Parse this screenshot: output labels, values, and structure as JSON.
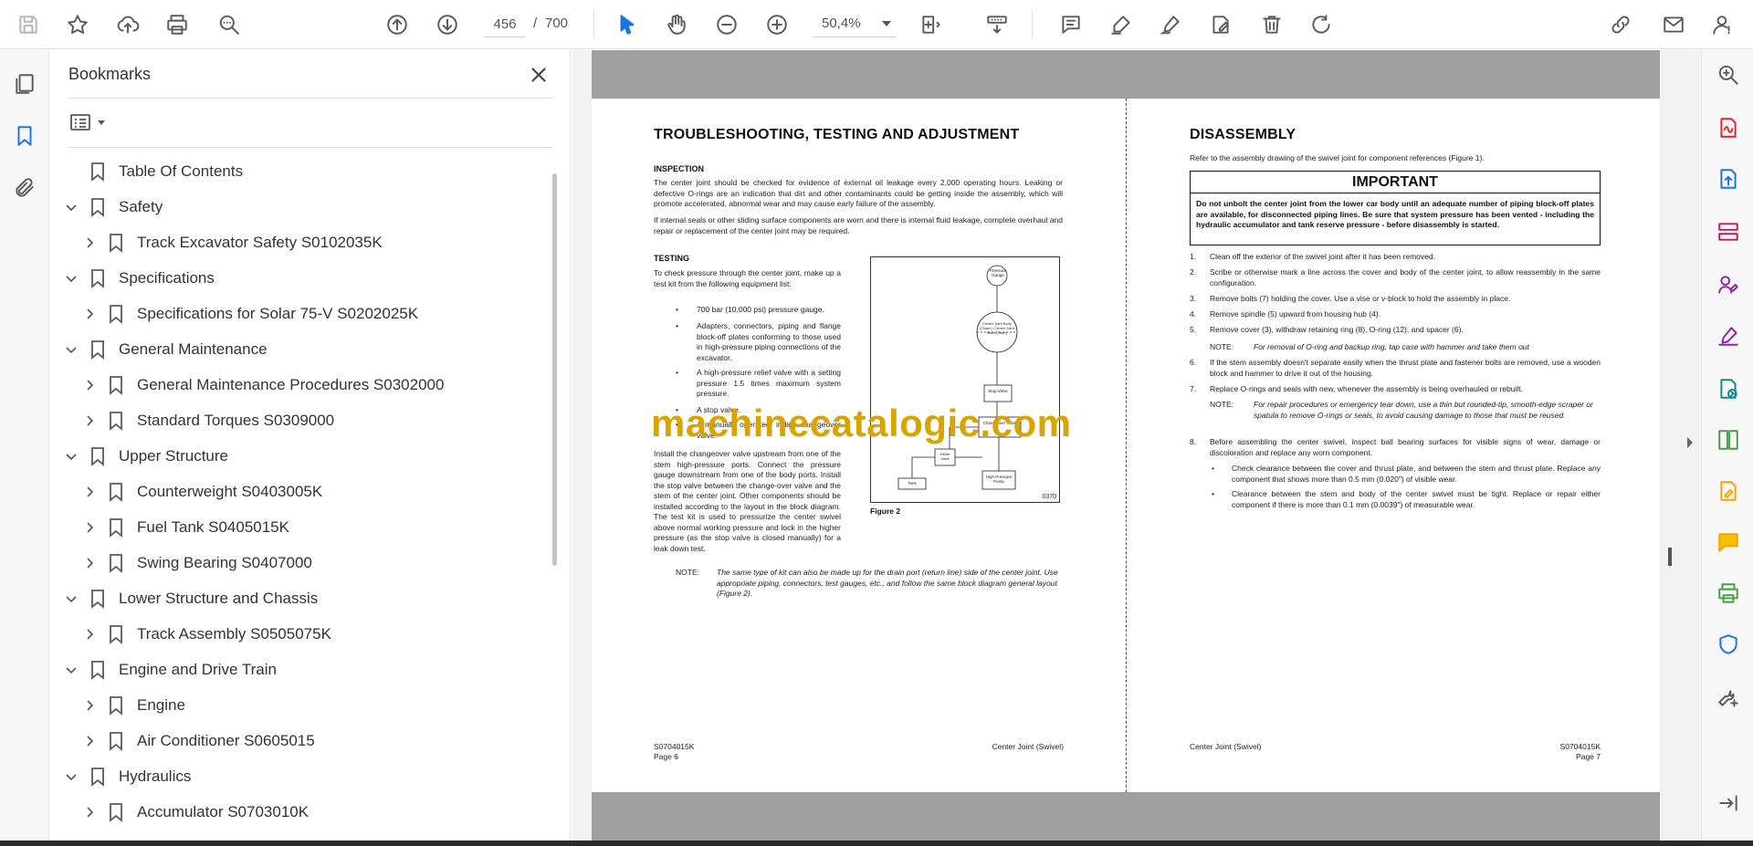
{
  "toolbar": {
    "current_page": "456",
    "page_separator": "/",
    "total_pages": "700",
    "zoom": "50,4%"
  },
  "bookmarks": {
    "title": "Bookmarks",
    "items": [
      {
        "label": "Table Of Contents",
        "level": 0,
        "expander": "none"
      },
      {
        "label": "Safety",
        "level": 0,
        "expander": "expanded"
      },
      {
        "label": "Track Excavator Safety S0102035K",
        "level": 1,
        "expander": "collapsed"
      },
      {
        "label": "Specifications",
        "level": 0,
        "expander": "expanded"
      },
      {
        "label": "Specifications for Solar 75-V S0202025K",
        "level": 1,
        "expander": "collapsed"
      },
      {
        "label": "General Maintenance",
        "level": 0,
        "expander": "expanded"
      },
      {
        "label": "General Maintenance Procedures S0302000",
        "level": 1,
        "expander": "collapsed"
      },
      {
        "label": "Standard Torques S0309000",
        "level": 1,
        "expander": "collapsed"
      },
      {
        "label": "Upper Structure",
        "level": 0,
        "expander": "expanded"
      },
      {
        "label": "Counterweight S0403005K",
        "level": 1,
        "expander": "collapsed"
      },
      {
        "label": "Fuel Tank S0405015K",
        "level": 1,
        "expander": "collapsed"
      },
      {
        "label": "Swing Bearing S0407000",
        "level": 1,
        "expander": "collapsed"
      },
      {
        "label": "Lower Structure and Chassis",
        "level": 0,
        "expander": "expanded"
      },
      {
        "label": "Track Assembly S0505075K",
        "level": 1,
        "expander": "collapsed"
      },
      {
        "label": "Engine and Drive Train",
        "level": 0,
        "expander": "expanded"
      },
      {
        "label": "Engine",
        "level": 1,
        "expander": "collapsed"
      },
      {
        "label": "Air Conditioner S0605015",
        "level": 1,
        "expander": "collapsed"
      },
      {
        "label": "Hydraulics",
        "level": 0,
        "expander": "expanded"
      },
      {
        "label": "Accumulator S0703010K",
        "level": 1,
        "expander": "collapsed"
      }
    ]
  },
  "left_page": {
    "heading": "TROUBLESHOOTING, TESTING AND ADJUSTMENT",
    "inspection_title": "INSPECTION",
    "inspection_p1": "The center joint should be checked for evidence of external oil leakage every 2,000 operating hours. Leaking or defective O-rings are an indication that dirt and other contaminants could be getting inside the assembly, which will promote accelerated, abnormal wear and may cause early failure of the assembly.",
    "inspection_p2": "If internal seals or other sliding surface components are worn and there is internal fluid leakage, complete overhaul and repair or replacement of the center joint may be required.",
    "testing_title": "TESTING",
    "testing_p1": "To check pressure through the center joint, make up a test kit from the following equipment list:",
    "bullets": [
      "700 bar (10,000 psi) pressure gauge.",
      "Adapters, connectors, piping and flange block-off plates conforming to those used in high-pressure piping connections of the excavator.",
      "A high-pressure relief valve with a setting pressure 1.5 times maximum system pressure.",
      "A stop valve.",
      "A manually operated, in-line changeover valve."
    ],
    "testing_p2": "Install the changeover valve upstream from one of the stem high-pressure ports. Connect the pressure gauge downstream from one of the body ports. Install the stop valve between the change-over valve and the stem of the center joint. Other components should be installed according to the layout in the block diagram. The test kit is used to pressurize the center swivel above normal working pressure and lock in the higher pressure (as the stop valve is closed manually) for a leak down test.",
    "note_label": "NOTE:",
    "note_text": "The same type of kit can also be made up for the drain port (return line) side of the center joint. Use appropriate piping, connectors, test gauges, etc., and follow the same block diagram general layout (Figure 2).",
    "figure_caption": "Figure 2",
    "figure_code": "0370",
    "fig_labels": {
      "gauge": "Pressure Gauge",
      "joint": "Center Joint Body (Outer) / Center Joint Stem (Inner)",
      "stop": "Stop Valve",
      "changeover": "Changeover Valve",
      "relief": "Relief Valve",
      "tank": "Tank",
      "pump": "High Pressure Pump"
    },
    "footer_code": "S0704015K",
    "footer_page": "Page 6",
    "footer_title": "Center Joint (Swivel)"
  },
  "right_page": {
    "heading": "DISASSEMBLY",
    "intro": "Refer to the assembly drawing of the swivel joint for component references (Figure 1).",
    "important_title": "IMPORTANT",
    "important_text": "Do not unbolt the center joint from the lower car body until an adequate number of piping block-off plates are available, for disconnected piping lines. Be sure that system pressure has been vented - including the hydraulic accumulator and tank reserve pressure - before disassembly is started.",
    "steps": [
      {
        "num": "1.",
        "text": "Clean off the exterior of the swivel joint after it has been removed."
      },
      {
        "num": "2.",
        "text": "Scribe or otherwise mark a line across the cover and body of the center joint, to allow reassembly in the same configuration."
      },
      {
        "num": "3.",
        "text": "Remove bolts (7) holding the cover. Use a vise or v-block to hold the assembly in place."
      },
      {
        "num": "4.",
        "text": "Remove spindle (5) upward from housing hub (4)."
      },
      {
        "num": "5.",
        "text": "Remove cover (3), withdraw retaining ring (8), O-ring (12), and spacer (6)."
      },
      {
        "num": "6.",
        "text": "If the stem assembly doesn't separate easily when the thrust plate and fastener bolts are removed, use a wooden block and hammer to drive it out of the housing."
      },
      {
        "num": "7.",
        "text": "Replace O-rings and seals with new, whenever the assembly is being overhauled or rebuilt."
      },
      {
        "num": "8.",
        "text": "Before assembling the center swivel, inspect ball bearing surfaces for visible signs of wear, damage or discoloration and replace any worn component."
      }
    ],
    "note1_label": "NOTE:",
    "note1_text": "For removal of O-ring and backup ring, tap case with hammer and take them out",
    "note2_label": "NOTE:",
    "note2_text": "For repair procedures or emergency tear down, use a thin but rounded-tip, smooth-edge scraper or spatula to remove O-rings or seals, to avoid causing damage to those that must be reused.",
    "sub_bullets": [
      "Check clearance between the cover and thrust plate, and between the stem and thrust plate. Replace any component that shows more than 0.5 mm (0.020\") of visible wear.",
      "Clearance between the stem and body of the center swivel must be tight. Replace or repair either component if there is more than 0.1 mm (0.0039\") of measurable wear."
    ],
    "footer_title": "Center Joint (Swivel)",
    "footer_code": "S0704015K",
    "footer_page": "Page 7"
  },
  "watermark": "machinecatalogic.com"
}
